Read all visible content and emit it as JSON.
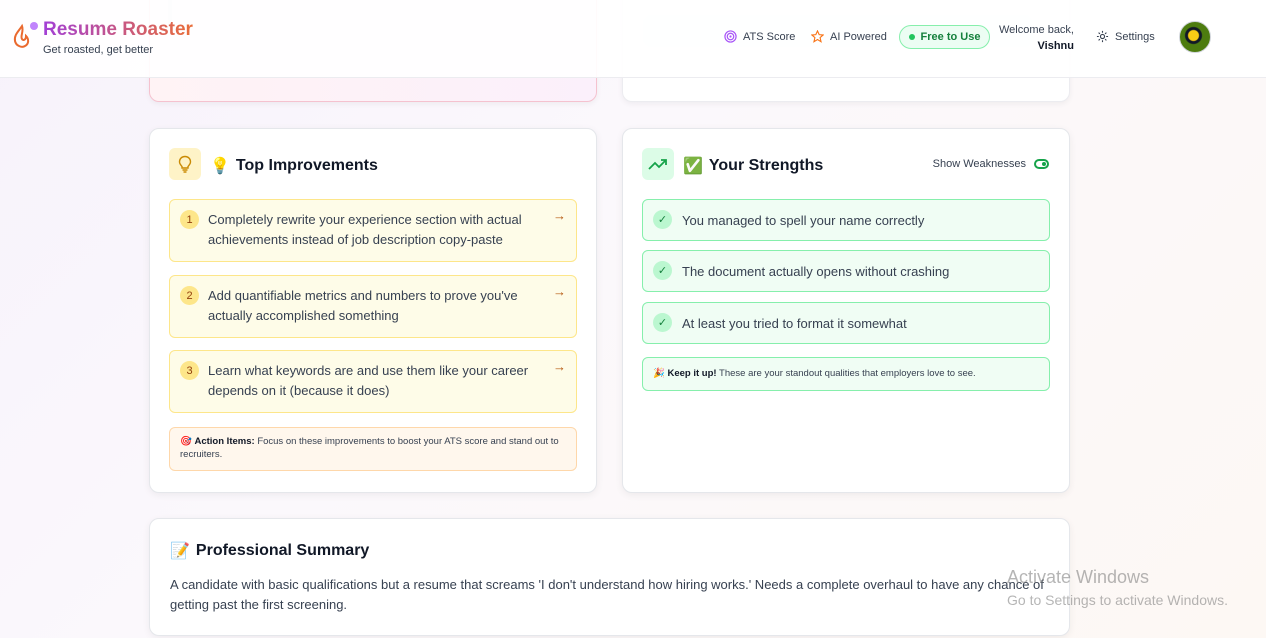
{
  "header": {
    "title": "Resume Roaster",
    "subtitle": "Get roasted, get better",
    "nav": {
      "ats": "ATS Score",
      "ai": "AI Powered",
      "free": "Free to Use",
      "settings": "Settings"
    },
    "welcome": "Welcome back,",
    "user_name": "Vishnu"
  },
  "improvements": {
    "title": "Top Improvements",
    "emoji": "💡",
    "items": [
      {
        "num": "1",
        "text": "Completely rewrite your experience section with actual achievements instead of job description copy-paste"
      },
      {
        "num": "2",
        "text": "Add quantifiable metrics and numbers to prove you've actually accomplished something"
      },
      {
        "num": "3",
        "text": "Learn what keywords are and use them like your career depends on it (because it does)"
      }
    ],
    "action_label": "Action Items:",
    "action_text": "Focus on these improvements to boost your ATS score and stand out to recruiters.",
    "action_emoji": "🎯"
  },
  "strengths": {
    "title": "Your Strengths",
    "emoji": "✅",
    "toggle_label": "Show Weaknesses",
    "items": [
      {
        "text": "You managed to spell your name correctly"
      },
      {
        "text": "The document actually opens without crashing"
      },
      {
        "text": "At least you tried to format it somewhat"
      }
    ],
    "keep_label": "Keep it up!",
    "keep_text": "These are your standout qualities that employers love to see.",
    "keep_emoji": "🎉"
  },
  "summary": {
    "title": "Professional Summary",
    "emoji": "📝",
    "text": "A candidate with basic qualifications but a resume that screams 'I don't understand how hiring works.' Needs a complete overhaul to have any chance of getting past the first screening."
  },
  "watermark": {
    "line1": "Activate Windows",
    "line2": "Go to Settings to activate Windows."
  },
  "colors": {
    "brand_start": "#a23fd6",
    "brand_end": "#e96d38",
    "improve_bg": "#fefce8",
    "strength_bg": "#f0fdf4"
  }
}
